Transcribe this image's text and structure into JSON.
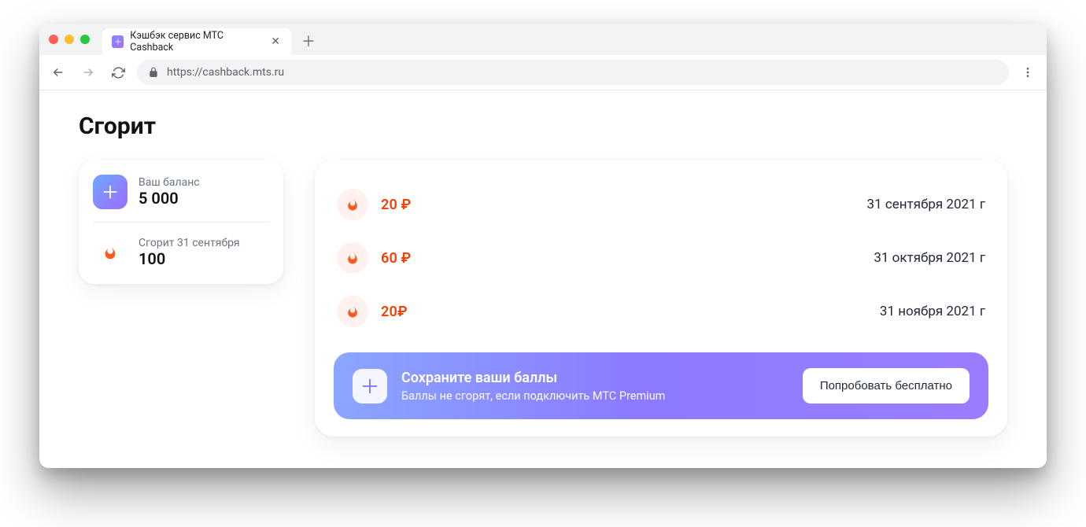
{
  "browser": {
    "tab_title": "Кэшбэк сервис МТС Cashback",
    "url": "https://cashback.mts.ru"
  },
  "page": {
    "title": "Сгорит"
  },
  "balance_card": {
    "balance_label": "Ваш баланс",
    "balance_value": "5 000",
    "expire_label": "Сгорит 31 сентября",
    "expire_value": "100"
  },
  "expires": [
    {
      "amount": "20 ₽",
      "date": "31 сентября 2021 г"
    },
    {
      "amount": "60 ₽",
      "date": "31 октября 2021 г"
    },
    {
      "amount": "20₽",
      "date": "31 ноября 2021 г"
    }
  ],
  "promo": {
    "title": "Сохраните ваши баллы",
    "subtitle": "Баллы не сгорят, если подключить МТС Premium",
    "cta": "Попробовать бесплатно"
  }
}
